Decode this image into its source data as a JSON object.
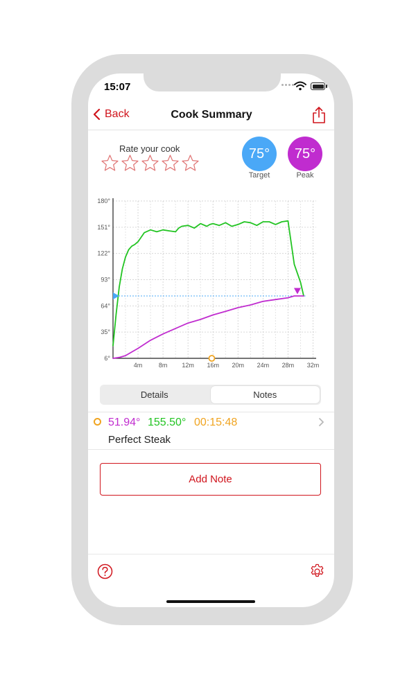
{
  "status_bar": {
    "time": "15:07"
  },
  "nav": {
    "back_label": "Back",
    "title": "Cook Summary"
  },
  "rating": {
    "label": "Rate your cook",
    "max_stars": 5,
    "value": 0
  },
  "badges": {
    "target": {
      "value": "75°",
      "label": "Target",
      "color": "#4aa8f7"
    },
    "peak": {
      "value": "75°",
      "label": "Peak",
      "color": "#c02ccf"
    }
  },
  "chart_data": {
    "type": "line",
    "y_ticks": [
      "180°",
      "151°",
      "122°",
      "93°",
      "64°",
      "35°",
      "6°"
    ],
    "x_ticks": [
      "4m",
      "8m",
      "12m",
      "16m",
      "20m",
      "24m",
      "28m",
      "32m"
    ],
    "xlim": [
      0,
      32.5
    ],
    "ylim": [
      6,
      180
    ],
    "grid": true,
    "target_line": 75,
    "series": [
      {
        "color": "#22c422",
        "x": [
          0,
          0.5,
          1,
          1.5,
          2,
          2.5,
          3,
          3.5,
          4,
          4.5,
          5,
          6,
          7,
          8,
          9,
          10,
          10.5,
          11,
          12,
          13,
          14,
          15,
          15.5,
          16,
          17,
          18,
          19,
          20,
          21,
          22,
          23,
          24,
          25,
          26,
          27,
          28,
          29,
          30,
          30.5
        ],
        "y": [
          20,
          55,
          85,
          105,
          118,
          126,
          130,
          132,
          135,
          140,
          145,
          148,
          146,
          148,
          147,
          146,
          150,
          152,
          153,
          150,
          155,
          152,
          154,
          155,
          153,
          156,
          152,
          154,
          157,
          156,
          153,
          157,
          157,
          154,
          157,
          158,
          110,
          90,
          75
        ]
      },
      {
        "color": "#c02ccf",
        "x": [
          0,
          1,
          2,
          3,
          4,
          6,
          8,
          10,
          12,
          14,
          16,
          18,
          20,
          22,
          24,
          26,
          28,
          29,
          30,
          30.5
        ],
        "y": [
          6,
          7,
          9,
          13,
          17,
          26,
          33,
          39,
          45,
          49,
          54,
          58,
          62,
          65,
          69,
          71,
          73,
          75,
          75,
          75
        ]
      }
    ],
    "peak_marker": {
      "x": 29.5,
      "y": 80,
      "color": "#c02ccf"
    },
    "target_marker": {
      "y": 75,
      "color": "#4aa8f7"
    },
    "time_marker": {
      "x": 15.8,
      "color": "#f0a420"
    }
  },
  "tabs": [
    {
      "label": "Details",
      "active": false
    },
    {
      "label": "Notes",
      "active": true
    }
  ],
  "note": {
    "probe1": "51.94°",
    "probe2": "155.50°",
    "time": "00:15:48",
    "title": "Perfect Steak"
  },
  "add_note_label": "Add Note",
  "colors": {
    "accent": "#d0141c"
  }
}
